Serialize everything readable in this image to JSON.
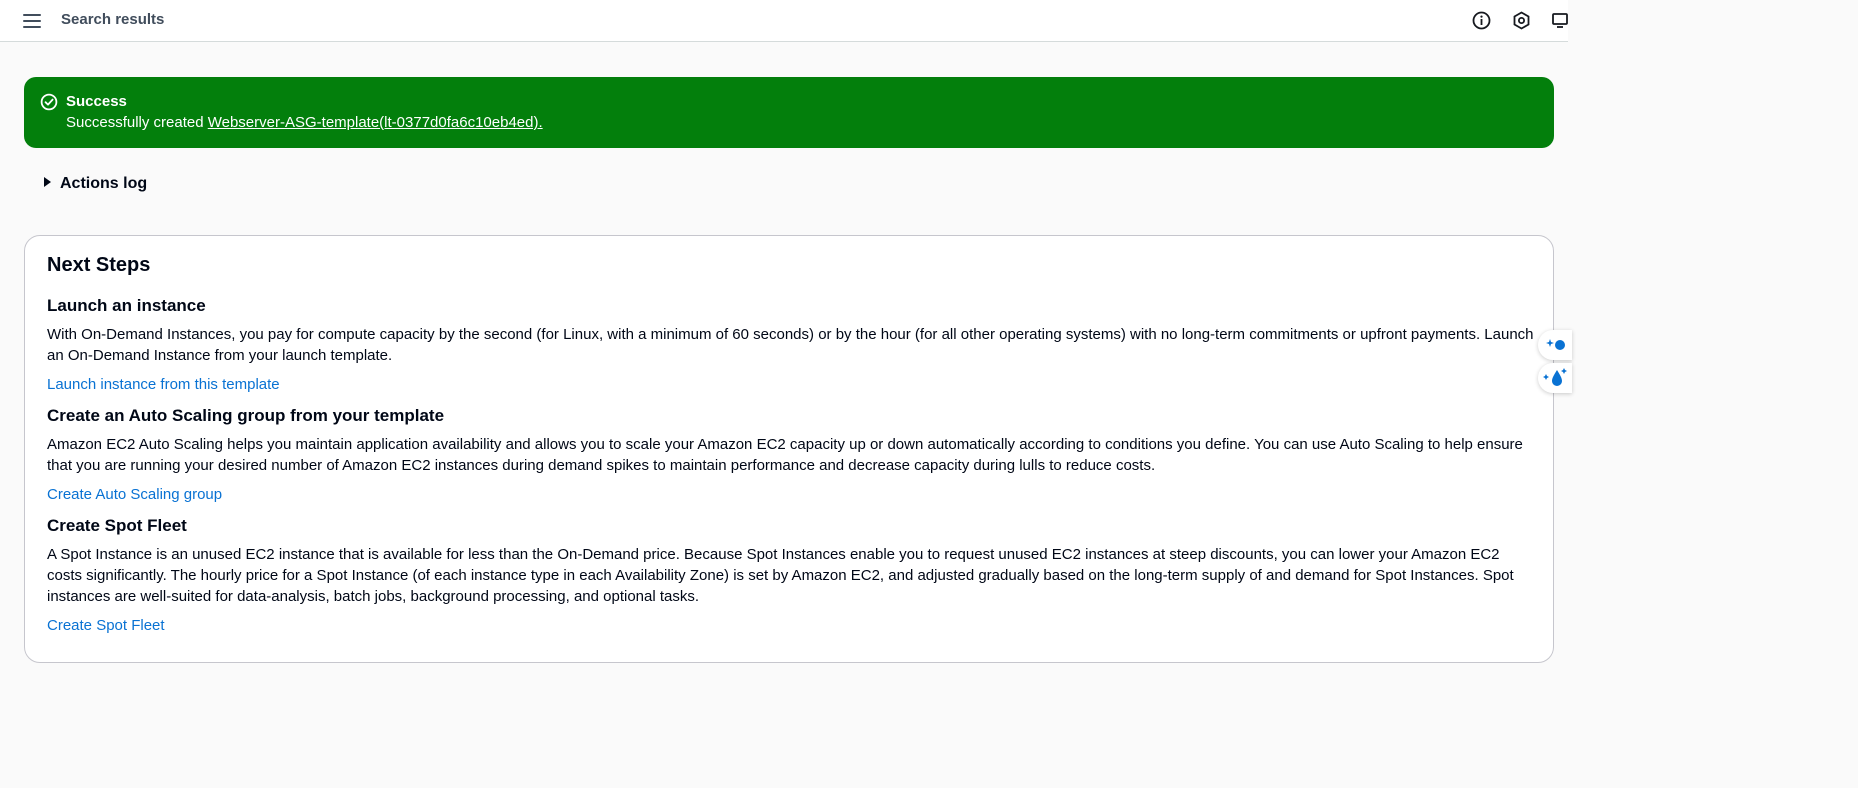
{
  "topbar": {
    "title": "Search results",
    "icons": [
      "menu-icon",
      "info-icon",
      "settings-hex-icon",
      "screen-icon"
    ]
  },
  "flash": {
    "type": "success",
    "title": "Success",
    "message_prefix": "Successfully created ",
    "link_text": "Webserver-ASG-template(lt-0377d0fa6c10eb4ed).",
    "color": "#037f0c"
  },
  "actions_log": {
    "label": "Actions log"
  },
  "next_steps": {
    "title": "Next Steps",
    "sections": [
      {
        "title": "Launch an instance",
        "text": "With On-Demand Instances, you pay for compute capacity by the second (for Linux, with a minimum of 60 seconds) or by the hour (for all other operating systems) with no long-term commitments or upfront payments. Launch an On-Demand Instance from your launch template.",
        "link": "Launch instance from this template"
      },
      {
        "title": "Create an Auto Scaling group from your template",
        "text": "Amazon EC2 Auto Scaling helps you maintain application availability and allows you to scale your Amazon EC2 capacity up or down automatically according to conditions you define. You can use Auto Scaling to help ensure that you are running your desired number of Amazon EC2 instances during demand spikes to maintain performance and decrease capacity during lulls to reduce costs.",
        "link": "Create Auto Scaling group"
      },
      {
        "title": "Create Spot Fleet",
        "text": "A Spot Instance is an unused EC2 instance that is available for less than the On-Demand price. Because Spot Instances enable you to request unused EC2 instances at steep discounts, you can lower your Amazon EC2 costs significantly. The hourly price for a Spot Instance (of each instance type in each Availability Zone) is set by Amazon EC2, and adjusted gradually based on the long-term supply of and demand for Spot Instances. Spot instances are well-suited for data-analysis, batch jobs, background processing, and optional tasks.",
        "link": "Create Spot Fleet"
      }
    ]
  },
  "colors": {
    "link": "#0972d3",
    "text": "#000716",
    "success": "#037f0c"
  }
}
